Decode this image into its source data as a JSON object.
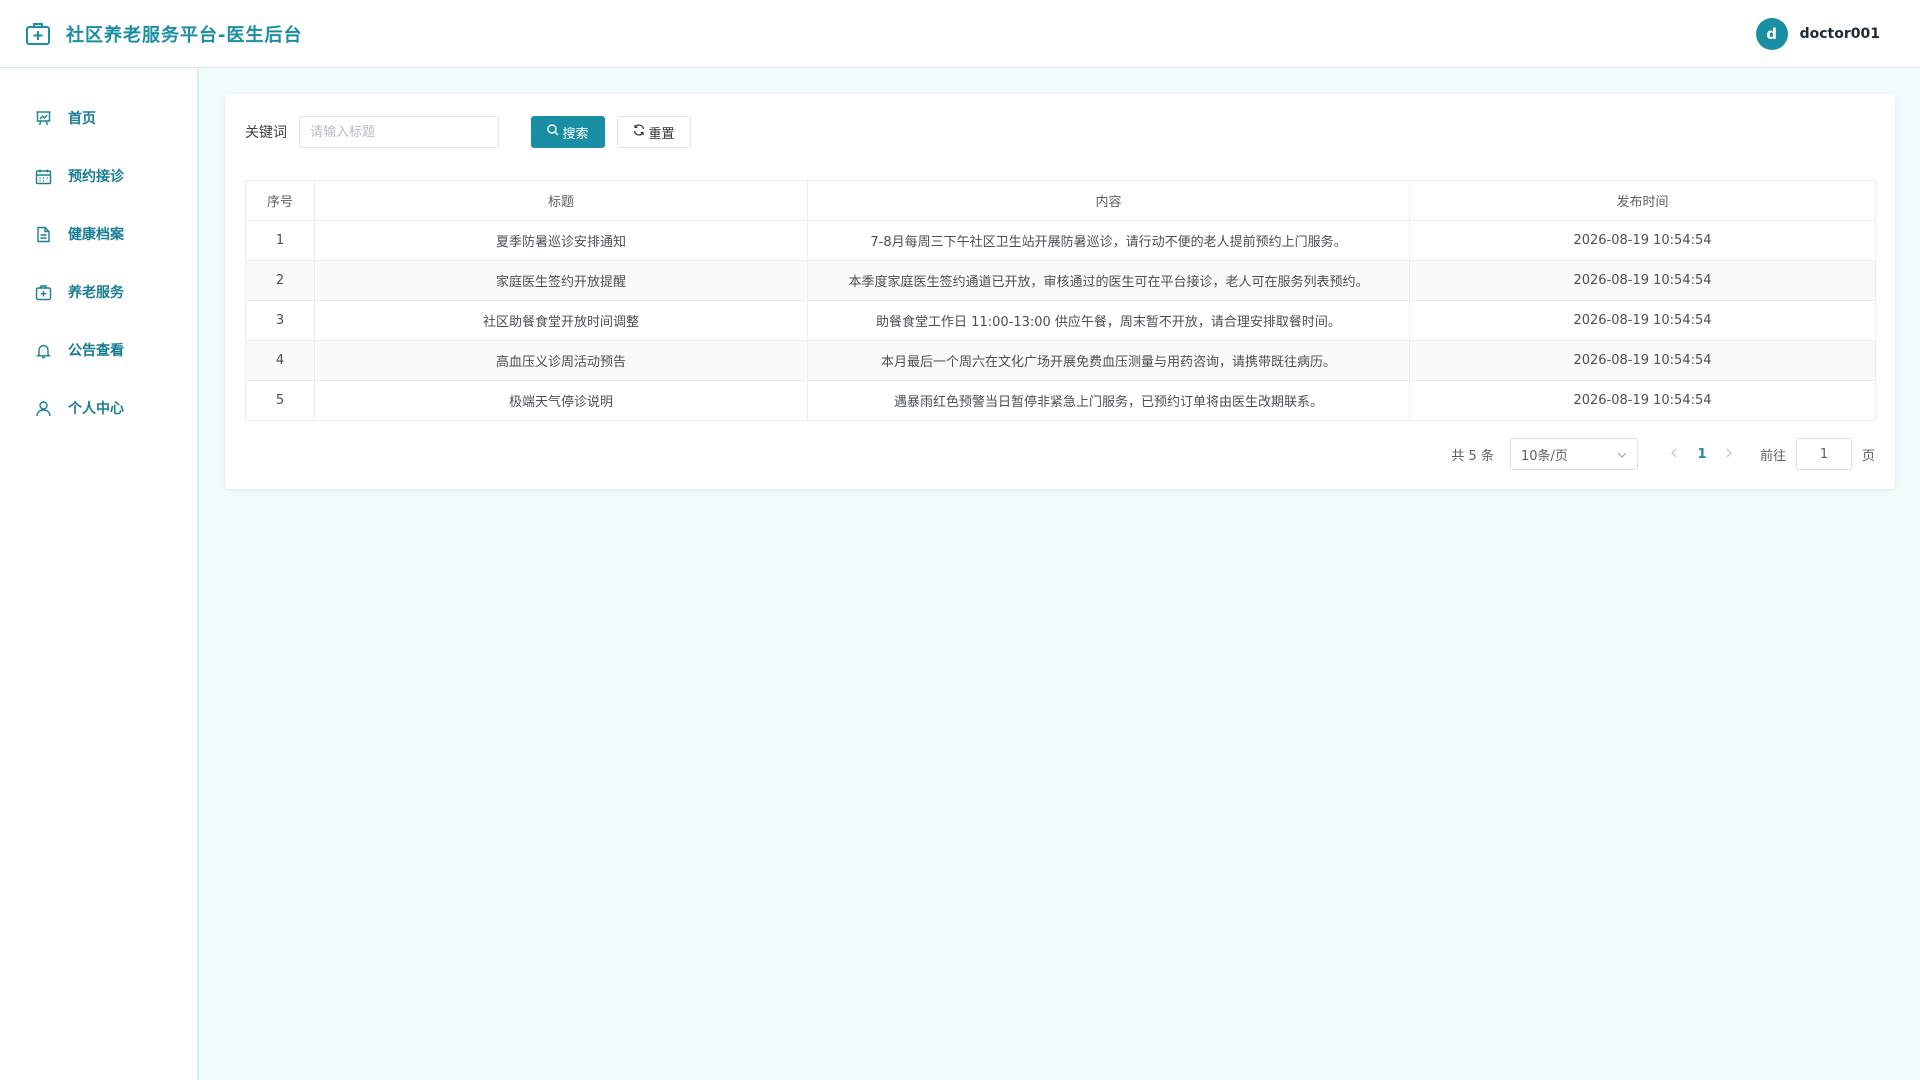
{
  "header": {
    "title": "社区养老服务平台-医生后台",
    "avatar_letter": "d",
    "username": "doctor001"
  },
  "sidebar": {
    "items": [
      {
        "label": "首页",
        "icon": "chart-icon"
      },
      {
        "label": "预约接诊",
        "icon": "calendar-icon"
      },
      {
        "label": "健康档案",
        "icon": "document-icon"
      },
      {
        "label": "养老服务",
        "icon": "medical-kit-icon"
      },
      {
        "label": "公告查看",
        "icon": "bell-icon"
      },
      {
        "label": "个人中心",
        "icon": "user-icon"
      }
    ],
    "active_index": 4
  },
  "search": {
    "label": "关键词",
    "placeholder": "请输入标题",
    "search_button": "搜索",
    "reset_button": "重置"
  },
  "table": {
    "headers": [
      "序号",
      "标题",
      "内容",
      "发布时间"
    ],
    "rows": [
      {
        "index": "1",
        "title": "夏季防暑巡诊安排通知",
        "content": "7-8月每周三下午社区卫生站开展防暑巡诊，请行动不便的老人提前预约上门服务。",
        "time": "2026-08-19 10:54:54"
      },
      {
        "index": "2",
        "title": "家庭医生签约开放提醒",
        "content": "本季度家庭医生签约通道已开放，审核通过的医生可在平台接诊，老人可在服务列表预约。",
        "time": "2026-08-19 10:54:54"
      },
      {
        "index": "3",
        "title": "社区助餐食堂开放时间调整",
        "content": "助餐食堂工作日 11:00-13:00 供应午餐，周末暂不开放，请合理安排取餐时间。",
        "time": "2026-08-19 10:54:54"
      },
      {
        "index": "4",
        "title": "高血压义诊周活动预告",
        "content": "本月最后一个周六在文化广场开展免费血压测量与用药咨询，请携带既往病历。",
        "time": "2026-08-19 10:54:54"
      },
      {
        "index": "5",
        "title": "极端天气停诊说明",
        "content": "遇暴雨红色预警当日暂停非紧急上门服务，已预约订单将由医生改期联系。",
        "time": "2026-08-19 10:54:54"
      }
    ]
  },
  "pagination": {
    "total_text": "共 5 条",
    "page_size": "10条/页",
    "current_page": "1",
    "goto_label": "前往",
    "goto_value": "1",
    "goto_suffix": "页"
  },
  "colors": {
    "accent": "#1a8ea3",
    "background": "#f1fbfb"
  }
}
